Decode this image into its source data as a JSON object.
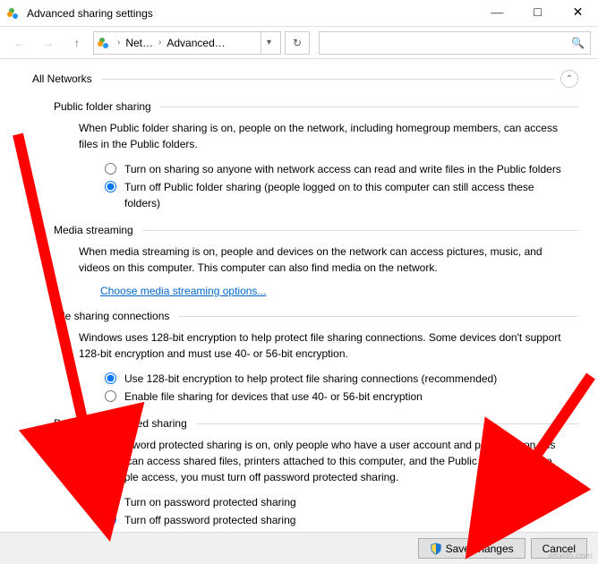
{
  "window": {
    "title": "Advanced sharing settings"
  },
  "nav": {
    "breadcrumb1": "Net…",
    "breadcrumb2": "Advanced…",
    "search_placeholder": ""
  },
  "group": {
    "title": "All Networks"
  },
  "public_folder": {
    "title": "Public folder sharing",
    "desc": "When Public folder sharing is on, people on the network, including homegroup members, can access files in the Public folders.",
    "opt_on": "Turn on sharing so anyone with network access can read and write files in the Public folders",
    "opt_off": "Turn off Public folder sharing (people logged on to this computer can still access these folders)"
  },
  "media": {
    "title": "Media streaming",
    "desc": "When media streaming is on, people and devices on the network can access pictures, music, and videos on this computer. This computer can also find media on the network.",
    "link": "Choose media streaming options..."
  },
  "filesharing": {
    "title": "File sharing connections",
    "desc": "Windows uses 128-bit encryption to help protect file sharing connections. Some devices don't support 128-bit encryption and must use 40- or 56-bit encryption.",
    "opt_128": "Use 128-bit encryption to help protect file sharing connections (recommended)",
    "opt_4056": "Enable file sharing for devices that use 40- or 56-bit encryption"
  },
  "password": {
    "title": "Password protected sharing",
    "desc": "When password protected sharing is on, only people who have a user account and password on this computer can access shared files, printers attached to this computer, and the Public folders. To give other people access, you must turn off password protected sharing.",
    "opt_on": "Turn on password protected sharing",
    "opt_off": "Turn off password protected sharing"
  },
  "footer": {
    "save": "Save changes",
    "cancel": "Cancel"
  },
  "watermark": "wsxdn.com"
}
